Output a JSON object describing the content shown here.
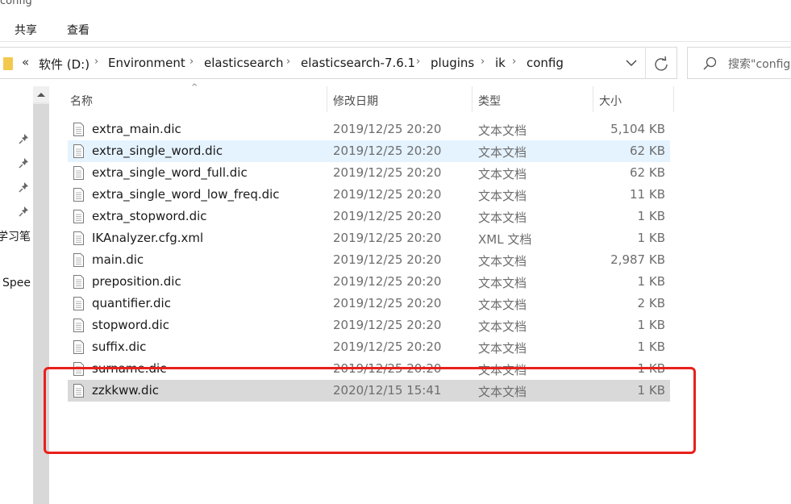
{
  "window": {
    "title": "config"
  },
  "ribbon": {
    "tabs": [
      "共享",
      "查看"
    ]
  },
  "address": {
    "lead": "«",
    "crumbs": [
      "软件 (D:)",
      "Environment",
      "elasticsearch",
      "elasticsearch-7.6.1",
      "plugins",
      "ik",
      "config"
    ],
    "separator": "›"
  },
  "search": {
    "placeholder": "搜索\"config\""
  },
  "nav": {
    "items": [
      "学习笔",
      "Spee"
    ]
  },
  "columns": {
    "name": "名称",
    "date": "修改日期",
    "type": "类型",
    "size": "大小"
  },
  "files": [
    {
      "name": "extra_main.dic",
      "date": "2019/12/25 20:20",
      "type": "文本文档",
      "size": "5,104 KB"
    },
    {
      "name": "extra_single_word.dic",
      "date": "2019/12/25 20:20",
      "type": "文本文档",
      "size": "62 KB",
      "state": "hover"
    },
    {
      "name": "extra_single_word_full.dic",
      "date": "2019/12/25 20:20",
      "type": "文本文档",
      "size": "62 KB"
    },
    {
      "name": "extra_single_word_low_freq.dic",
      "date": "2019/12/25 20:20",
      "type": "文本文档",
      "size": "11 KB"
    },
    {
      "name": "extra_stopword.dic",
      "date": "2019/12/25 20:20",
      "type": "文本文档",
      "size": "1 KB"
    },
    {
      "name": "IKAnalyzer.cfg.xml",
      "date": "2019/12/25 20:20",
      "type": "XML 文档",
      "size": "1 KB"
    },
    {
      "name": "main.dic",
      "date": "2019/12/25 20:20",
      "type": "文本文档",
      "size": "2,987 KB"
    },
    {
      "name": "preposition.dic",
      "date": "2019/12/25 20:20",
      "type": "文本文档",
      "size": "1 KB"
    },
    {
      "name": "quantifier.dic",
      "date": "2019/12/25 20:20",
      "type": "文本文档",
      "size": "2 KB"
    },
    {
      "name": "stopword.dic",
      "date": "2019/12/25 20:20",
      "type": "文本文档",
      "size": "1 KB"
    },
    {
      "name": "suffix.dic",
      "date": "2019/12/25 20:20",
      "type": "文本文档",
      "size": "1 KB"
    },
    {
      "name": "surname.dic",
      "date": "2019/12/25 20:20",
      "type": "文本文档",
      "size": "1 KB"
    },
    {
      "name": "zzkkww.dic",
      "date": "2020/12/15 15:41",
      "type": "文本文档",
      "size": "1 KB",
      "state": "selected"
    }
  ],
  "colors": {
    "highlight": "#e8201c",
    "hover": "#e5f3ff",
    "selected": "#d9d9d9",
    "folder": "#f3c94d"
  }
}
